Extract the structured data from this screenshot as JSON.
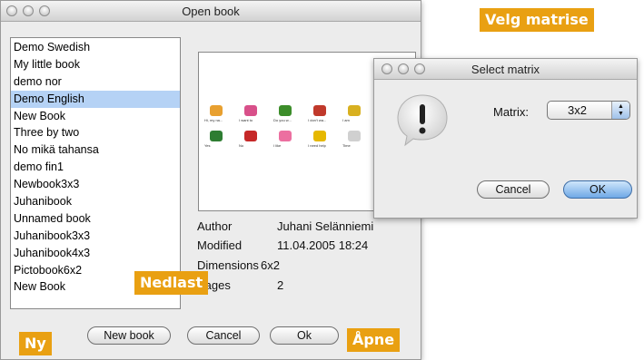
{
  "open_dialog": {
    "title": "Open book",
    "books": [
      "Demo Swedish",
      "My little book",
      "demo nor",
      "Demo English",
      "New Book",
      "Three by two",
      "No mikä tahansa",
      "demo fin1",
      "Newbook3x3",
      "Juhanibook",
      "Unnamed book",
      "Juhanibook3x3",
      "Juhanibook4x3",
      "Pictobook6x2",
      "New Book"
    ],
    "selected_book": "Demo English",
    "preview_captions_row1": [
      "Hi, my na...",
      "I want to",
      "Do you w...",
      "I don't wa...",
      "I am",
      "You are"
    ],
    "preview_captions_row2": [
      "Yes",
      "No",
      "I like",
      "I need help",
      "Time",
      "Question"
    ],
    "info": [
      {
        "label": "Author",
        "value": "Juhani Selänniemi"
      },
      {
        "label": "Modified",
        "value": "11.04.2005 18:24"
      },
      {
        "label": "Dimensions",
        "value": "6x2"
      },
      {
        "label": "Pages",
        "value": "2"
      }
    ],
    "buttons": {
      "new_book": "New book",
      "cancel": "Cancel",
      "ok": "Ok"
    }
  },
  "matrix_dialog": {
    "title": "Select matrix",
    "matrix_label": "Matrix:",
    "matrix_value": "3x2",
    "cancel": "Cancel",
    "ok": "OK"
  },
  "callouts": {
    "velg_matrise": "Velg matrise",
    "nedlast": "Nedlast",
    "ny": "Ny",
    "apne": "Åpne"
  },
  "colors": {
    "callout": "#e9a012",
    "selection": "#b5d2f5"
  }
}
